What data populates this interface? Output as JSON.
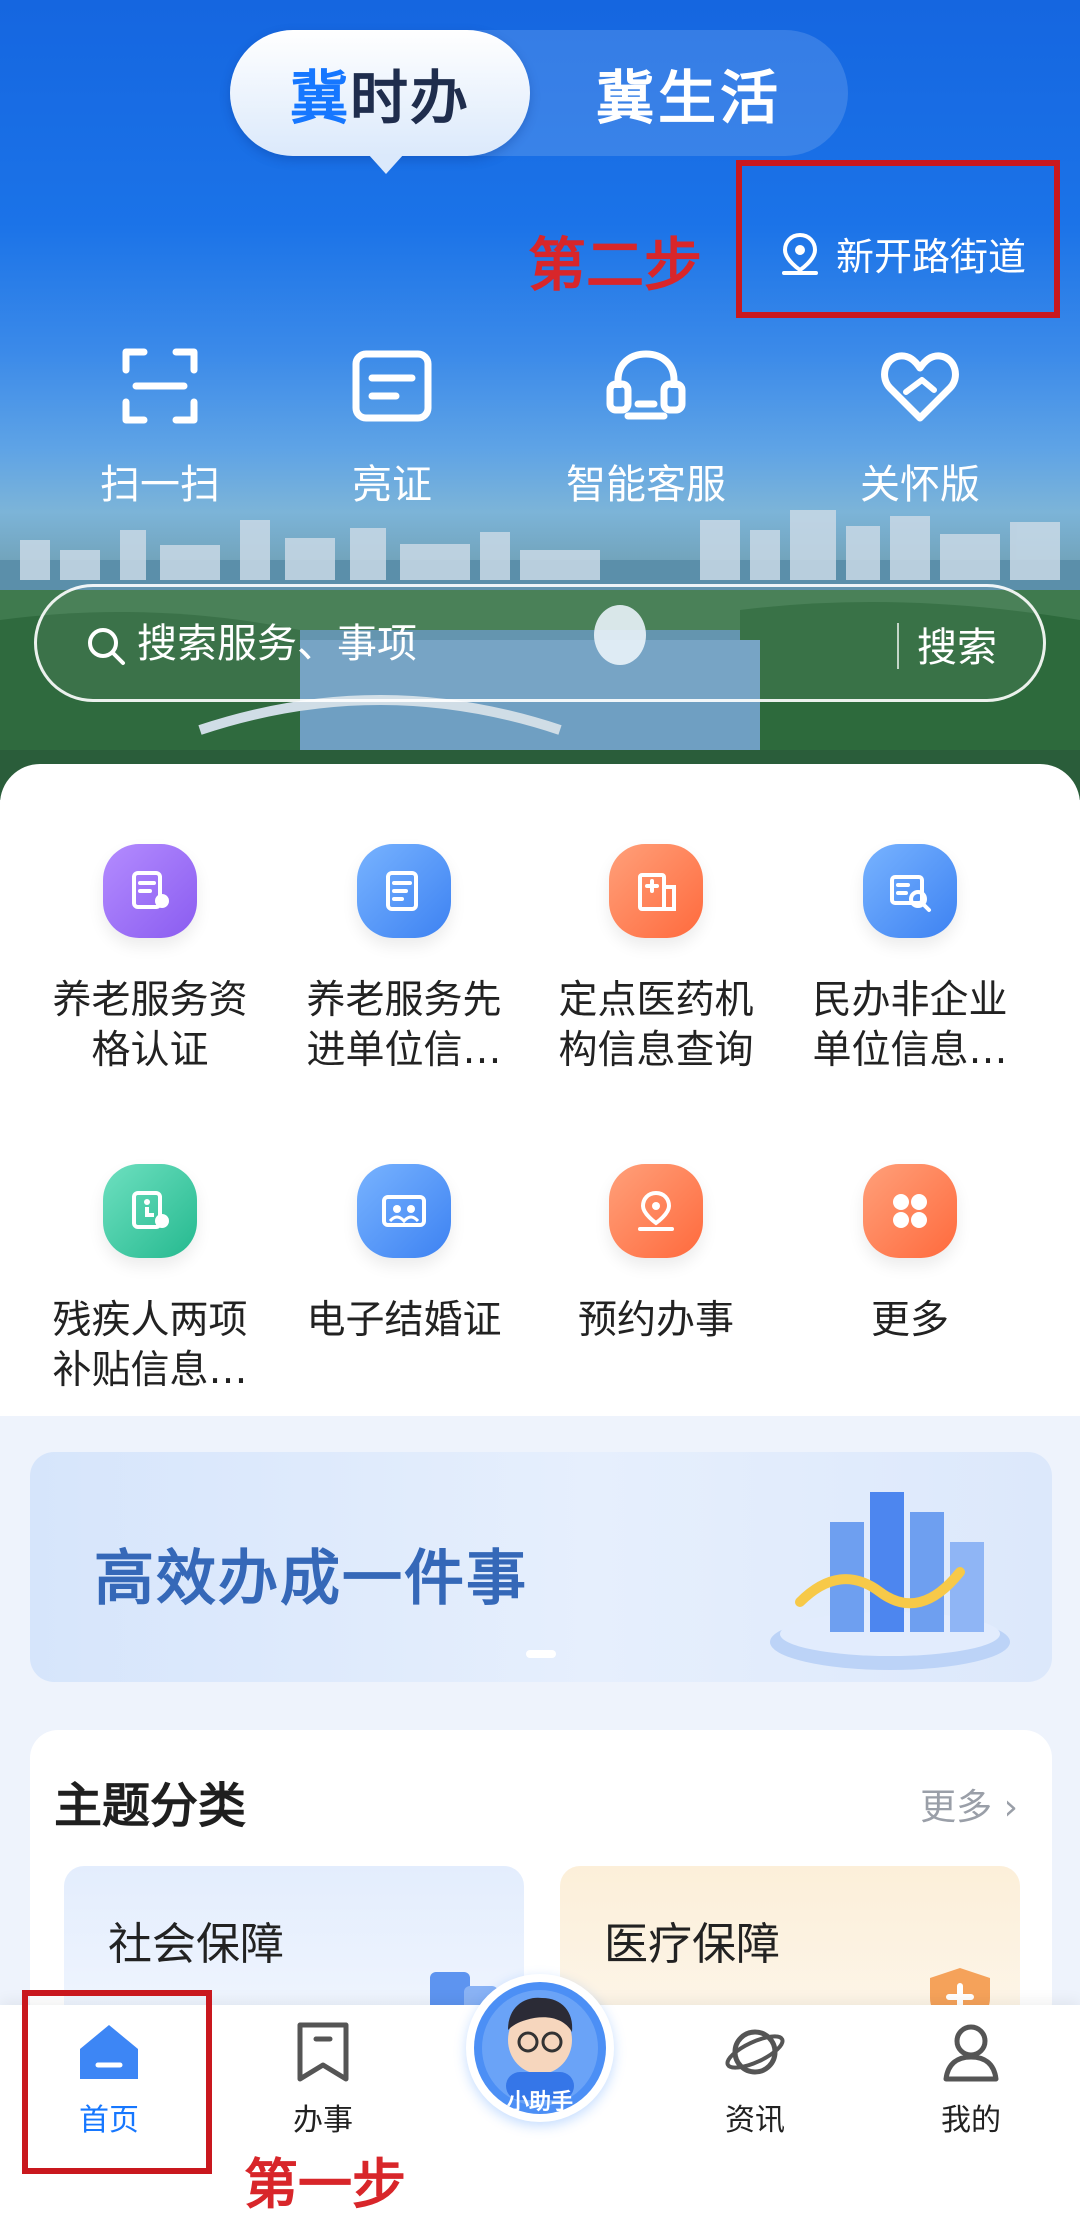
{
  "top_tabs": {
    "active": {
      "accent": "冀",
      "rest": "时办"
    },
    "inactive": "冀生活"
  },
  "annotations": {
    "step1": "第一步",
    "step2": "第二步",
    "highlight_color": "#c9181e"
  },
  "location": {
    "name": "新开路街道",
    "icon": "location-pin-icon"
  },
  "quick_actions": [
    {
      "label": "扫一扫",
      "icon": "scan-icon"
    },
    {
      "label": "亮证",
      "icon": "id-card-icon"
    },
    {
      "label": "智能客服",
      "icon": "headset-icon"
    },
    {
      "label": "关怀版",
      "icon": "care-heart-icon"
    }
  ],
  "search": {
    "placeholder": "搜索服务、事项",
    "button": "搜索"
  },
  "services": [
    {
      "label": "养老服务资格认证",
      "icon": "pension-certify-icon",
      "color": "#9b6ff0"
    },
    {
      "label": "养老服务先进单位信息查询",
      "icon": "pension-unit-icon",
      "color": "#4f93f6"
    },
    {
      "label": "定点医药机构信息查询",
      "icon": "hospital-icon",
      "color": "#ff7a4e"
    },
    {
      "label": "民办非企业单位信息查询",
      "icon": "org-search-icon",
      "color": "#4f93f6"
    },
    {
      "label": "残疾人两项补贴信息查询",
      "icon": "disability-icon",
      "color": "#35c9a1"
    },
    {
      "label": "电子结婚证",
      "icon": "marriage-cert-icon",
      "color": "#4f93f6"
    },
    {
      "label": "预约办事",
      "icon": "appointment-icon",
      "color": "#ff7a4e"
    },
    {
      "label": "更多",
      "icon": "more-grid-icon",
      "color": "#ff7a4e"
    }
  ],
  "banner": {
    "title": "高效办成一件事"
  },
  "topics": {
    "title": "主题分类",
    "more": "更多",
    "items": [
      {
        "label": "社会保障"
      },
      {
        "label": "医疗保障"
      }
    ]
  },
  "bottom_nav": {
    "items": [
      {
        "label": "首页",
        "icon": "home-icon",
        "active": true
      },
      {
        "label": "办事",
        "icon": "bookmark-icon",
        "active": false
      },
      {
        "label": "资讯",
        "icon": "planet-icon",
        "active": false
      },
      {
        "label": "我的",
        "icon": "profile-icon",
        "active": false
      }
    ],
    "assistant": {
      "label": "小助手",
      "icon": "assistant-avatar-icon"
    }
  },
  "colors": {
    "brand_blue": "#1677ff",
    "hero_blue": "#1566e0"
  }
}
